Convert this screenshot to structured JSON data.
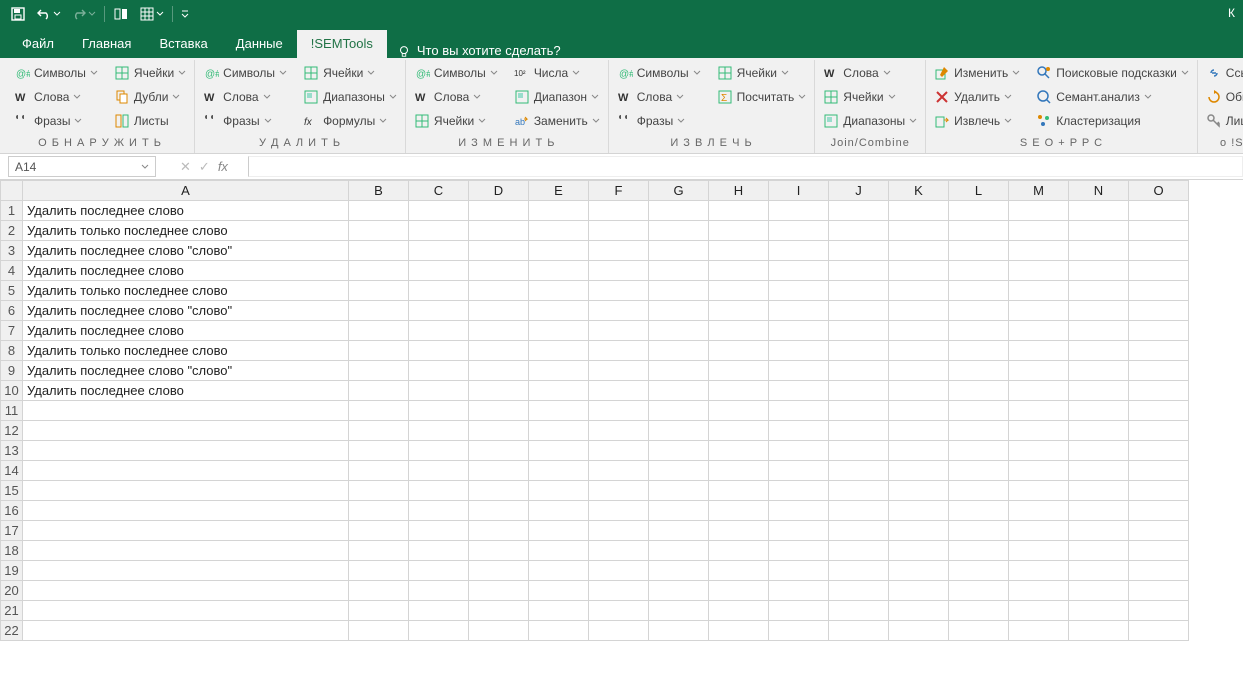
{
  "qat": {
    "tip": "К"
  },
  "tabs": [
    {
      "label": "Файл"
    },
    {
      "label": "Главная"
    },
    {
      "label": "Вставка"
    },
    {
      "label": "Данные"
    },
    {
      "label": "!SEMTools"
    }
  ],
  "tellme": "Что вы хотите сделать?",
  "ribbon": [
    {
      "label": "О Б Н А Р У Ж И Т Ь",
      "cols": [
        [
          {
            "t": "Символы"
          },
          {
            "t": "Слова"
          },
          {
            "t": "Фразы"
          }
        ],
        [
          {
            "t": "Ячейки"
          },
          {
            "t": "Дубли"
          },
          {
            "t": "Листы"
          }
        ]
      ]
    },
    {
      "label": "У Д А Л И Т Ь",
      "cols": [
        [
          {
            "t": "Символы"
          },
          {
            "t": "Слова"
          },
          {
            "t": "Фразы"
          }
        ],
        [
          {
            "t": "Ячейки"
          },
          {
            "t": "Диапазоны"
          },
          {
            "t": "Формулы"
          }
        ]
      ]
    },
    {
      "label": "И З М Е Н И Т Ь",
      "cols": [
        [
          {
            "t": "Символы"
          },
          {
            "t": "Слова"
          },
          {
            "t": "Ячейки"
          }
        ],
        [
          {
            "t": "Числа"
          },
          {
            "t": "Диапазон"
          },
          {
            "t": "Заменить"
          }
        ]
      ]
    },
    {
      "label": "И З В Л Е Ч Ь",
      "cols": [
        [
          {
            "t": "Символы"
          },
          {
            "t": "Слова"
          },
          {
            "t": "Фразы"
          }
        ],
        [
          {
            "t": "Ячейки"
          },
          {
            "t": "Посчитать"
          }
        ]
      ]
    },
    {
      "label": "Join/Combine",
      "cols": [
        [
          {
            "t": "Слова"
          },
          {
            "t": "Ячейки"
          },
          {
            "t": "Диапазоны"
          }
        ]
      ]
    },
    {
      "label": "S E O + P P C",
      "cols": [
        [
          {
            "t": "Изменить"
          },
          {
            "t": "Удалить"
          },
          {
            "t": "Извлечь"
          }
        ],
        [
          {
            "t": "Поисковые подсказки"
          },
          {
            "t": "Семант.анализ"
          },
          {
            "t": "Кластеризация"
          }
        ]
      ]
    },
    {
      "label": "о !SEMTools",
      "cols": [
        [
          {
            "t": "Ссылки"
          },
          {
            "t": "Обновление"
          },
          {
            "t": "Лицензия"
          }
        ]
      ]
    }
  ],
  "namebox": "A14",
  "columns": [
    "A",
    "B",
    "C",
    "D",
    "E",
    "F",
    "G",
    "H",
    "I",
    "J",
    "K",
    "L",
    "M",
    "N",
    "O"
  ],
  "rows": [
    {
      "n": 1,
      "a": "Удалить последнее слово"
    },
    {
      "n": 2,
      "a": "Удалить только последнее слово"
    },
    {
      "n": 3,
      "a": "Удалить последнее слово \"слово\""
    },
    {
      "n": 4,
      "a": "Удалить последнее слово"
    },
    {
      "n": 5,
      "a": "Удалить только последнее слово"
    },
    {
      "n": 6,
      "a": "Удалить последнее слово \"слово\""
    },
    {
      "n": 7,
      "a": "Удалить последнее слово"
    },
    {
      "n": 8,
      "a": "Удалить только последнее слово"
    },
    {
      "n": 9,
      "a": "Удалить последнее слово \"слово\""
    },
    {
      "n": 10,
      "a": "Удалить последнее слово"
    },
    {
      "n": 11,
      "a": ""
    },
    {
      "n": 12,
      "a": ""
    },
    {
      "n": 13,
      "a": ""
    },
    {
      "n": 14,
      "a": ""
    },
    {
      "n": 15,
      "a": ""
    },
    {
      "n": 16,
      "a": ""
    },
    {
      "n": 17,
      "a": ""
    },
    {
      "n": 18,
      "a": ""
    },
    {
      "n": 19,
      "a": ""
    },
    {
      "n": 20,
      "a": ""
    },
    {
      "n": 21,
      "a": ""
    },
    {
      "n": 22,
      "a": ""
    }
  ],
  "icons": {
    "symbols": "glyph",
    "words": "w",
    "phrases": "quote",
    "cells": "grid",
    "sheets": "sheets",
    "dups": "dups",
    "ranges": "ranges",
    "formulas": "fx",
    "numbers": "102",
    "replace": "ab",
    "count": "sigma",
    "edit": "pencil",
    "del": "x",
    "extract": "extract",
    "hints": "search",
    "semantic": "mag",
    "cluster": "clust",
    "links": "link",
    "update": "refresh",
    "license": "key"
  }
}
